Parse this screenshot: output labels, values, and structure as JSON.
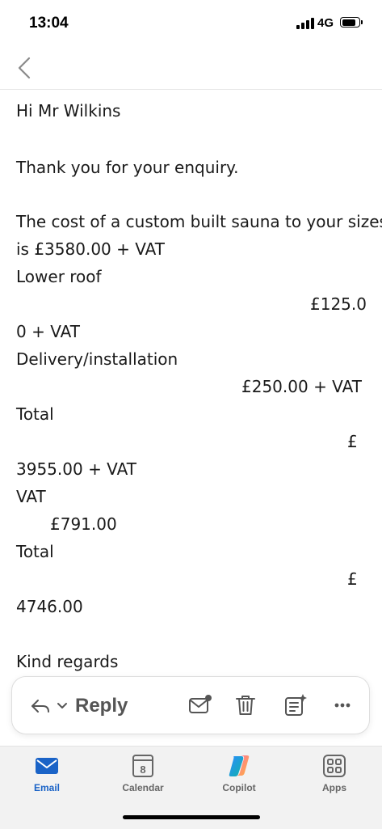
{
  "status": {
    "time": "13:04",
    "network": "4G",
    "battery_level": 0.85
  },
  "email": {
    "lines": [
      "Hi Mr Wilkins",
      "Thank you for your enquiry.",
      "The cost of a custom built sauna to your sizes",
      "is   £3580.00 + VAT",
      "Lower roof",
      "£125.0",
      "0 + VAT",
      "Delivery/installation",
      "£250.00 + VAT",
      "Total",
      "£",
      "3955.00 + VAT",
      "VAT",
      "£791.00",
      "Total",
      "£",
      "4746.00",
      "Kind regards"
    ]
  },
  "toolbar": {
    "reply_label": "Reply"
  },
  "tabs": [
    {
      "label": "Email",
      "icon": "mail-icon",
      "active": true
    },
    {
      "label": "Calendar",
      "icon": "calendar-icon",
      "date": "8"
    },
    {
      "label": "Copilot",
      "icon": "copilot-icon"
    },
    {
      "label": "Apps",
      "icon": "apps-icon"
    }
  ],
  "colors": {
    "accent": "#1a63c7",
    "text": "#1a1a1a",
    "icon": "#555555"
  }
}
